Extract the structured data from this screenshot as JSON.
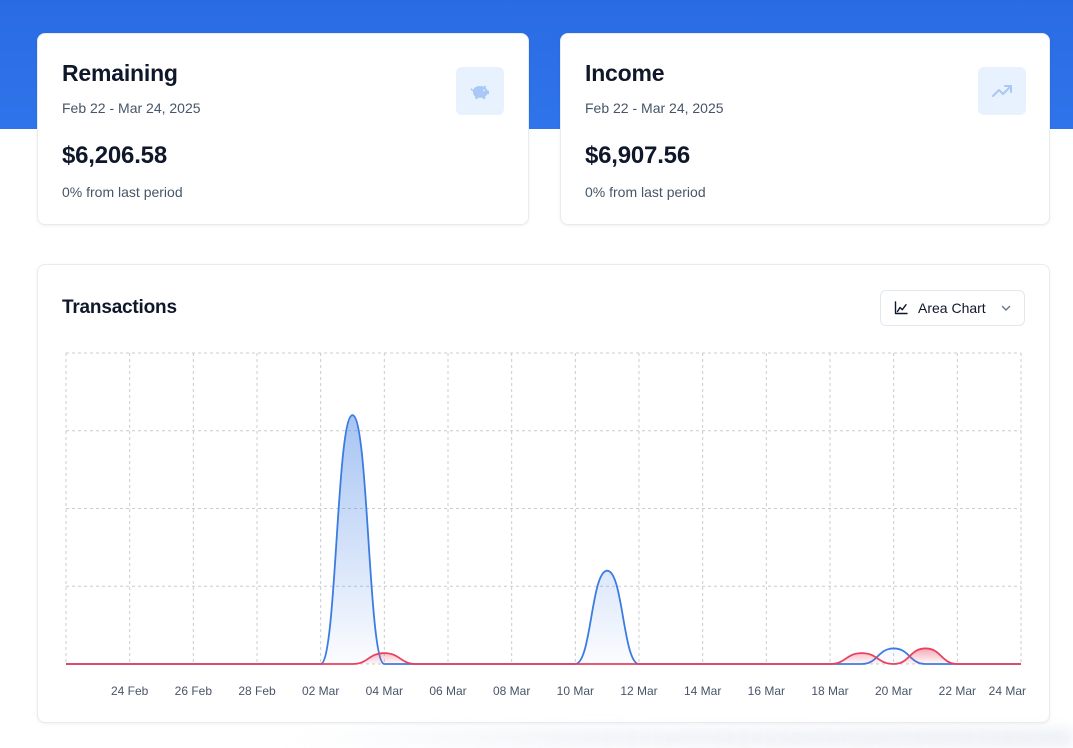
{
  "cards": {
    "remaining": {
      "title": "Remaining",
      "date_range": "Feb 22 - Mar 24, 2025",
      "value": "$6,206.58",
      "change": "0% from last period",
      "icon": "piggy-bank-icon"
    },
    "income": {
      "title": "Income",
      "date_range": "Feb 22 - Mar 24, 2025",
      "value": "$6,907.56",
      "change": "0% from last period",
      "icon": "trending-up-icon"
    }
  },
  "transactions": {
    "title": "Transactions",
    "chart_type_label": "Area Chart",
    "icons": {
      "chart_type": "area-chart-icon",
      "dropdown": "chevron-down-icon"
    }
  },
  "colors": {
    "brand": "#2a6be3",
    "income_series": "#3b7ce3",
    "expense_series": "#e8415e",
    "icon_bg": "#e8f1fe"
  },
  "chart_data": {
    "type": "area",
    "title": "",
    "xlabel": "",
    "ylabel": "",
    "x": [
      "22 Feb",
      "23 Feb",
      "24 Feb",
      "25 Feb",
      "26 Feb",
      "27 Feb",
      "28 Feb",
      "01 Mar",
      "02 Mar",
      "03 Mar",
      "04 Mar",
      "05 Mar",
      "06 Mar",
      "07 Mar",
      "08 Mar",
      "09 Mar",
      "10 Mar",
      "11 Mar",
      "12 Mar",
      "13 Mar",
      "14 Mar",
      "15 Mar",
      "16 Mar",
      "17 Mar",
      "18 Mar",
      "19 Mar",
      "20 Mar",
      "21 Mar",
      "22 Mar",
      "23 Mar",
      "24 Mar"
    ],
    "x_tick_labels": [
      "24 Feb",
      "26 Feb",
      "28 Feb",
      "02 Mar",
      "04 Mar",
      "06 Mar",
      "08 Mar",
      "10 Mar",
      "12 Mar",
      "14 Mar",
      "16 Mar",
      "18 Mar",
      "20 Mar",
      "22 Mar",
      "24 Mar"
    ],
    "ylim": [
      0,
      4
    ],
    "grid": true,
    "y_axis_labels_shown": false,
    "legend": "none",
    "series": [
      {
        "values": [
          0,
          0,
          0,
          0,
          0,
          0,
          0,
          0,
          0,
          3.2,
          0,
          0,
          0,
          0,
          0,
          0,
          0,
          1.2,
          0,
          0,
          0,
          0,
          0,
          0,
          0,
          0,
          0.2,
          0,
          0,
          0,
          0
        ],
        "color": "#3b7ce3"
      },
      {
        "values": [
          0,
          0,
          0,
          0,
          0,
          0,
          0,
          0,
          0,
          0,
          0.14,
          0,
          0,
          0,
          0,
          0,
          0,
          0,
          0,
          0,
          0,
          0,
          0,
          0,
          0,
          0.14,
          0,
          0.2,
          0,
          0,
          0
        ],
        "color": "#e8415e"
      }
    ]
  }
}
